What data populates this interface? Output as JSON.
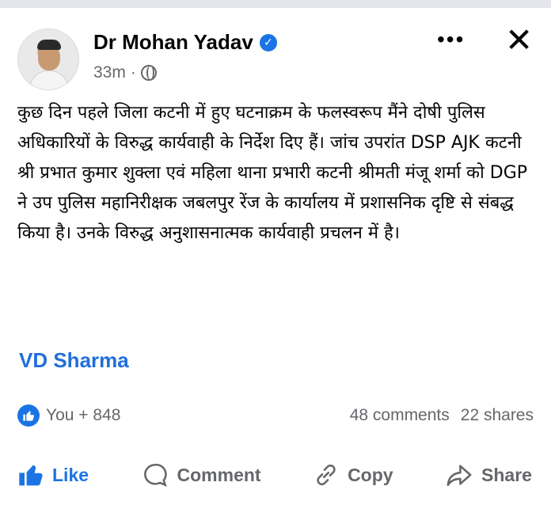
{
  "post": {
    "author": "Dr Mohan Yadav",
    "time": "33m",
    "dot": "·",
    "text": "कुछ दिन पहले जिला कटनी में हुए घटनाक्रम के फलस्वरूप मैंने दोषी पुलिस अधिकारियों के विरुद्ध कार्यवाही के निर्देश दिए हैं। जांच उपरांत DSP AJK कटनी श्री प्रभात कुमार शुक्ला एवं महिला थाना प्रभारी कटनी श्रीमती मंजू शर्मा को DGP ने उप पुलिस महानिरीक्षक जबलपुर रेंज के कार्यालय में प्रशासनिक दृष्टि से संबद्ध किया है। उनके विरुद्ध अनुशासनात्मक कार्यवाही प्रचलन में है।",
    "tag": "VD Sharma"
  },
  "header_icons": {
    "more": "•••",
    "close": "✕",
    "verified": "✓"
  },
  "stats": {
    "reactions": "You + 848",
    "comments": "48 comments",
    "shares": "22 shares"
  },
  "actions": {
    "like": "Like",
    "comment": "Comment",
    "copy": "Copy",
    "share": "Share"
  },
  "colors": {
    "accent": "#1b74e4",
    "tag": "#216fdb",
    "muted": "#65676b"
  },
  "icons": [
    "verified-icon",
    "globe-icon",
    "more-icon",
    "close-icon",
    "like-reaction-icon",
    "like-icon",
    "comment-icon",
    "copy-icon",
    "share-icon"
  ]
}
